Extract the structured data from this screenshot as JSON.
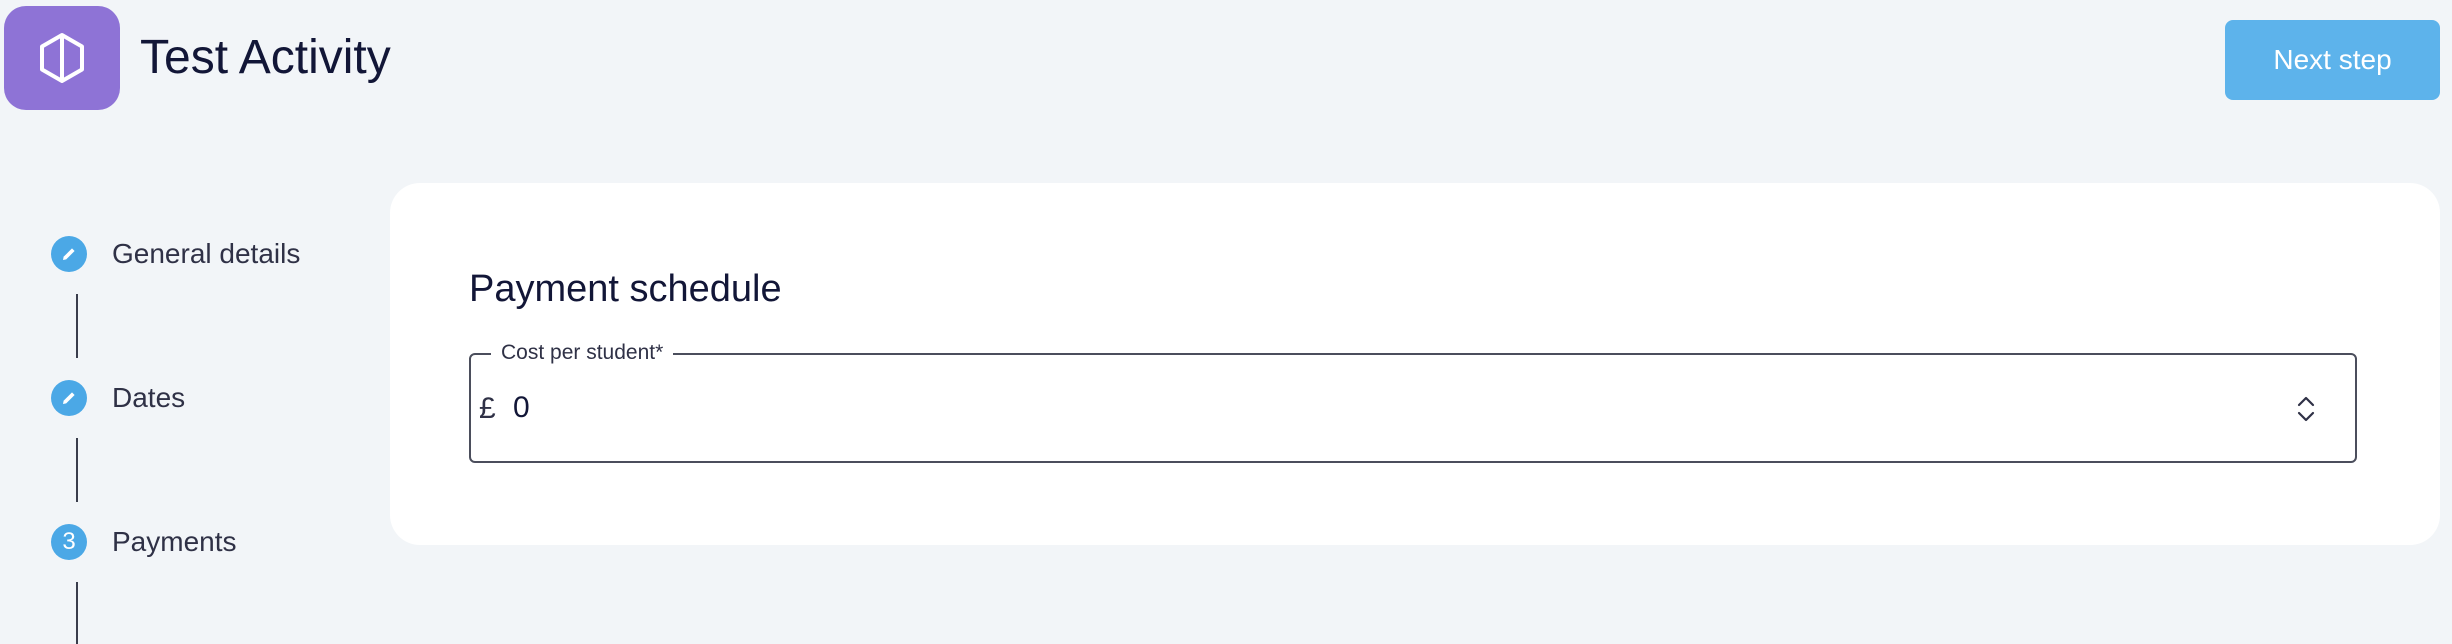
{
  "header": {
    "logo_icon": "hexagon-split-icon",
    "title": "Test Activity",
    "next_step_label": "Next step"
  },
  "stepper": {
    "steps": [
      {
        "label": "General details",
        "state": "completed",
        "icon": "pencil-icon",
        "marker": ""
      },
      {
        "label": "Dates",
        "state": "completed",
        "icon": "pencil-icon",
        "marker": ""
      },
      {
        "label": "Payments",
        "state": "current",
        "icon": "",
        "marker": "3"
      }
    ]
  },
  "payment_schedule": {
    "title": "Payment schedule",
    "cost_field": {
      "label": "Cost per student*",
      "currency": "£",
      "value": "0",
      "control_icon": "up-down-chevron-icon"
    }
  },
  "colors": {
    "background": "#f2f5f8",
    "logo": "#8e73d6",
    "accent": "#5db3eb",
    "step_icon": "#4ba8e6",
    "text": "#121637"
  }
}
